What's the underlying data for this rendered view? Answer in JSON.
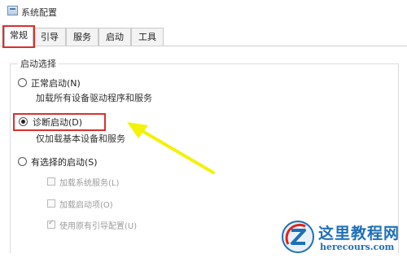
{
  "window": {
    "title": "系统配置"
  },
  "tabs": [
    {
      "label": "常规",
      "active": true
    },
    {
      "label": "引导"
    },
    {
      "label": "服务"
    },
    {
      "label": "启动"
    },
    {
      "label": "工具"
    }
  ],
  "group": {
    "label": "启动选择"
  },
  "options": {
    "normal": {
      "label": "正常启动(N)",
      "desc": "加载所有设备驱动程序和服务",
      "selected": false
    },
    "diagnostic": {
      "label": "诊断启动(D)",
      "desc": "仅加载基本设备和服务",
      "selected": true
    },
    "selective": {
      "label": "有选择的启动(S)",
      "selected": false
    }
  },
  "selective_items": [
    {
      "label": "加载系统服务(L)",
      "checked": false
    },
    {
      "label": "加载启动项(O)",
      "checked": false
    },
    {
      "label": "使用原有引导配置(U)",
      "checked": true
    }
  ],
  "annotations": {
    "highlight_color": "#d9302c",
    "arrow_color": "#f2f20a"
  },
  "watermark": {
    "title": "这里教程网",
    "url": "herecours.com",
    "logo_icon": "z-logo-icon"
  }
}
